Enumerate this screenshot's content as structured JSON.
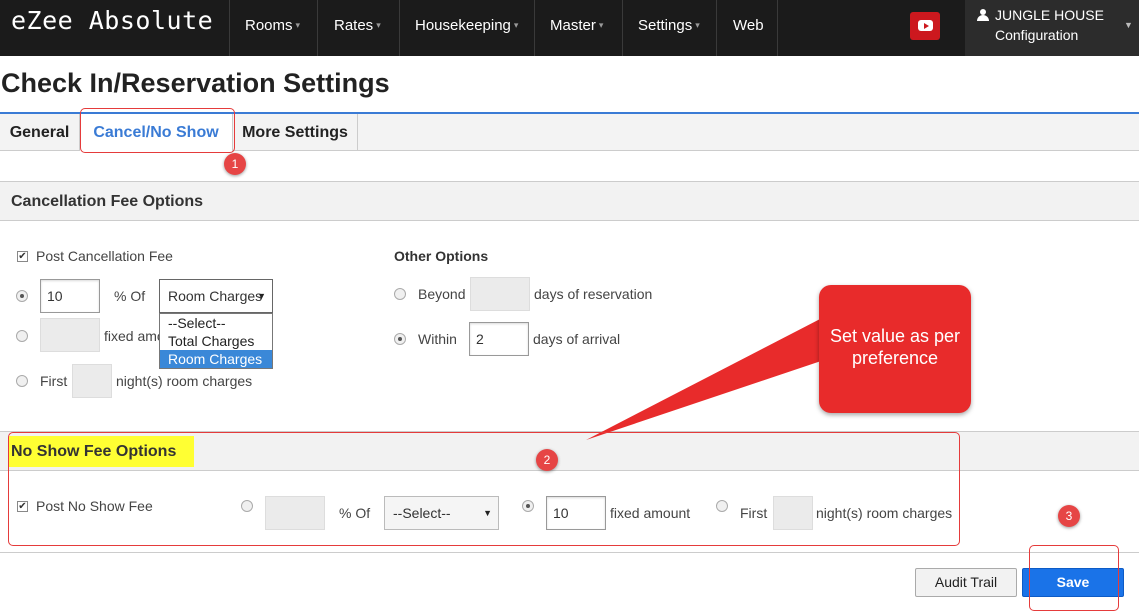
{
  "app": {
    "brand": "eZee Absolute"
  },
  "nav": {
    "items": [
      {
        "label": "Rooms",
        "caret": "▾"
      },
      {
        "label": "Rates",
        "caret": "▾"
      },
      {
        "label": "Housekeeping",
        "caret": "▾"
      },
      {
        "label": "Master",
        "caret": "▾"
      },
      {
        "label": "Settings",
        "caret": "▾"
      },
      {
        "label": "Web",
        "caret": ""
      }
    ],
    "user_name": "JUNGLE HOUSE",
    "user_role": "Configuration"
  },
  "page": {
    "title": "Check In/Reservation Settings"
  },
  "tabs": [
    {
      "label": "General"
    },
    {
      "label": "Cancel/No Show"
    },
    {
      "label": "More Settings"
    }
  ],
  "cancellation": {
    "section_title": "Cancellation Fee Options",
    "post_label": "Post Cancellation Fee",
    "percent_value": "10",
    "percent_of_label": "% Of",
    "percent_of_selected": "Room Charges",
    "percent_of_options": [
      "--Select--",
      "Total Charges",
      "Room Charges"
    ],
    "fixed_label": "fixed amount",
    "first_label": "First",
    "nights_label": "night(s) room charges",
    "other_title": "Other Options",
    "beyond_label": "Beyond",
    "beyond_suffix": "days of reservation",
    "within_label": "Within",
    "within_value": "2",
    "within_suffix": "days of arrival"
  },
  "noshow": {
    "section_title": "No Show Fee Options",
    "post_label": "Post No Show Fee",
    "percent_of_label": "% Of",
    "percent_of_selected": "--Select--",
    "fixed_value": "10",
    "fixed_label": "fixed amount",
    "first_label": "First",
    "nights_label": "night(s) room charges"
  },
  "annotations": {
    "callout": "Set value as per preference",
    "badges": [
      "1",
      "2",
      "3"
    ]
  },
  "footer": {
    "audit_label": "Audit Trail",
    "save_label": "Save"
  },
  "colors": {
    "accent": "#3a7bd5",
    "annotation": "#e82b2b",
    "highlight": "#ffff33",
    "save": "#1a73e8"
  },
  "icons": {
    "youtube": "youtube-icon",
    "user": "user-icon"
  }
}
